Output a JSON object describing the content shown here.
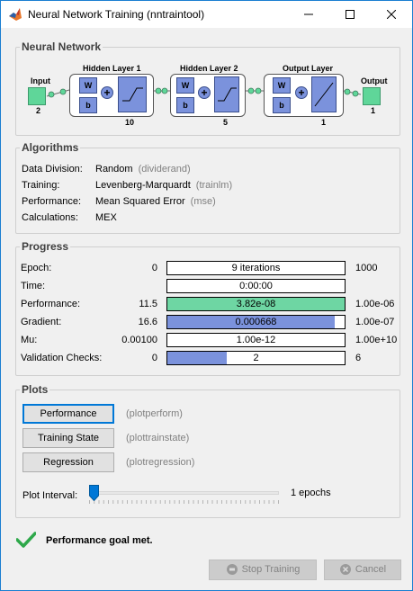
{
  "window": {
    "title": "Neural Network Training (nntraintool)",
    "controls": [
      "minimize-icon",
      "maximize-icon",
      "close-icon"
    ]
  },
  "network": {
    "section_title": "Neural Network",
    "input_label": "Input",
    "input_size": "2",
    "layers": [
      {
        "title": "Hidden Layer 1",
        "size": "10",
        "w": "W",
        "b": "b"
      },
      {
        "title": "Hidden Layer 2",
        "size": "5",
        "w": "W",
        "b": "b"
      },
      {
        "title": "Output Layer",
        "size": "1",
        "w": "W",
        "b": "b"
      }
    ],
    "output_label": "Output",
    "output_size": "1"
  },
  "algorithms": {
    "section_title": "Algorithms",
    "rows": [
      {
        "label": "Data Division:",
        "value": "Random",
        "fn": "(dividerand)"
      },
      {
        "label": "Training:",
        "value": "Levenberg-Marquardt",
        "fn": "(trainlm)"
      },
      {
        "label": "Performance:",
        "value": "Mean Squared Error",
        "fn": "(mse)"
      },
      {
        "label": "Calculations:",
        "value": "MEX",
        "fn": ""
      }
    ]
  },
  "progress": {
    "section_title": "Progress",
    "rows": [
      {
        "label": "Epoch:",
        "start": "0",
        "current": "9 iterations",
        "end": "1000",
        "fill": 0,
        "fill_color": "#ffffff"
      },
      {
        "label": "Time:",
        "start": "",
        "current": "0:00:00",
        "end": "",
        "fill": 0,
        "fill_color": "#ffffff"
      },
      {
        "label": "Performance:",
        "start": "11.5",
        "current": "3.82e-08",
        "end": "1.00e-06",
        "fill": 1.0,
        "fill_color": "#6ed6a3"
      },
      {
        "label": "Gradient:",
        "start": "16.6",
        "current": "0.000668",
        "end": "1.00e-07",
        "fill": 0.945,
        "fill_color": "#7b92dc"
      },
      {
        "label": "Mu:",
        "start": "0.00100",
        "current": "1.00e-12",
        "end": "1.00e+10",
        "fill": 0,
        "fill_color": "#ffffff"
      },
      {
        "label": "Validation Checks:",
        "start": "0",
        "current": "2",
        "end": "6",
        "fill": 0.333,
        "fill_color": "#7b92dc"
      }
    ]
  },
  "plots": {
    "section_title": "Plots",
    "buttons": [
      {
        "label": "Performance",
        "fn": "(plotperform)"
      },
      {
        "label": "Training State",
        "fn": "(plottrainstate)"
      },
      {
        "label": "Regression",
        "fn": "(plotregression)"
      }
    ],
    "interval_label": "Plot Interval:",
    "interval_value": "1 epochs",
    "interval_fraction": 0.0
  },
  "status": {
    "text": "Performance goal met.",
    "icon": "checkmark-icon"
  },
  "actions": {
    "stop_label": "Stop Training",
    "cancel_label": "Cancel"
  },
  "colors": {
    "accent": "#1b7fd1",
    "performance_fill": "#6ed6a3",
    "bar_fill": "#7b92dc",
    "layer_block": "#7b92dc",
    "io_block": "#5fd699"
  }
}
